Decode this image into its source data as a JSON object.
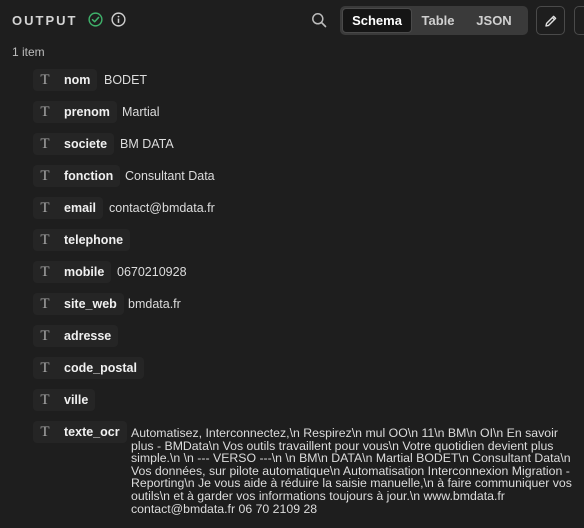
{
  "header": {
    "title": "OUTPUT",
    "tabs": [
      {
        "label": "Schema",
        "active": true
      },
      {
        "label": "Table",
        "active": false
      },
      {
        "label": "JSON",
        "active": false
      }
    ]
  },
  "count_label": "1 item",
  "type_glyph": "T",
  "fields": [
    {
      "key": "nom",
      "value": "BODET"
    },
    {
      "key": "prenom",
      "value": "Martial"
    },
    {
      "key": "societe",
      "value": "BM DATA"
    },
    {
      "key": "fonction",
      "value": "Consultant Data"
    },
    {
      "key": "email",
      "value": "contact@bmdata.fr"
    },
    {
      "key": "telephone",
      "value": ""
    },
    {
      "key": "mobile",
      "value": "0670210928"
    },
    {
      "key": "site_web",
      "value": "bmdata.fr"
    },
    {
      "key": "adresse",
      "value": ""
    },
    {
      "key": "code_postal",
      "value": ""
    },
    {
      "key": "ville",
      "value": ""
    },
    {
      "key": "texte_ocr",
      "value": "Automatisez, Interconnectez,\\n Respirez\\n mul OO\\n 11\\n BM\\n OI\\n En savoir plus - BMData\\n Vos outils travaillent pour vous\\n Votre quotidien devient plus simple.\\n \\n --- VERSO ---\\n \\n BM\\n DATA\\n Martial BODET\\n Consultant Data\\n Vos données, sur pilote automatique\\n Automatisation Interconnexion Migration - Reporting\\n Je vous aide à réduire la saisie manuelle,\\n à faire communiquer vos outils\\n et à garder vos informations toujours à jour.\\n www.bmdata.fr contact@bmdata.fr 06 70 2109 28"
    }
  ],
  "colors": {
    "background": "#1e1e1e",
    "success": "#3fb26b",
    "tab_active_bg": "#151515",
    "tab_group_bg": "#3a3a3a"
  },
  "icons": [
    "check-circle-icon",
    "info-icon",
    "search-icon",
    "pencil-icon",
    "text-type-icon"
  ]
}
